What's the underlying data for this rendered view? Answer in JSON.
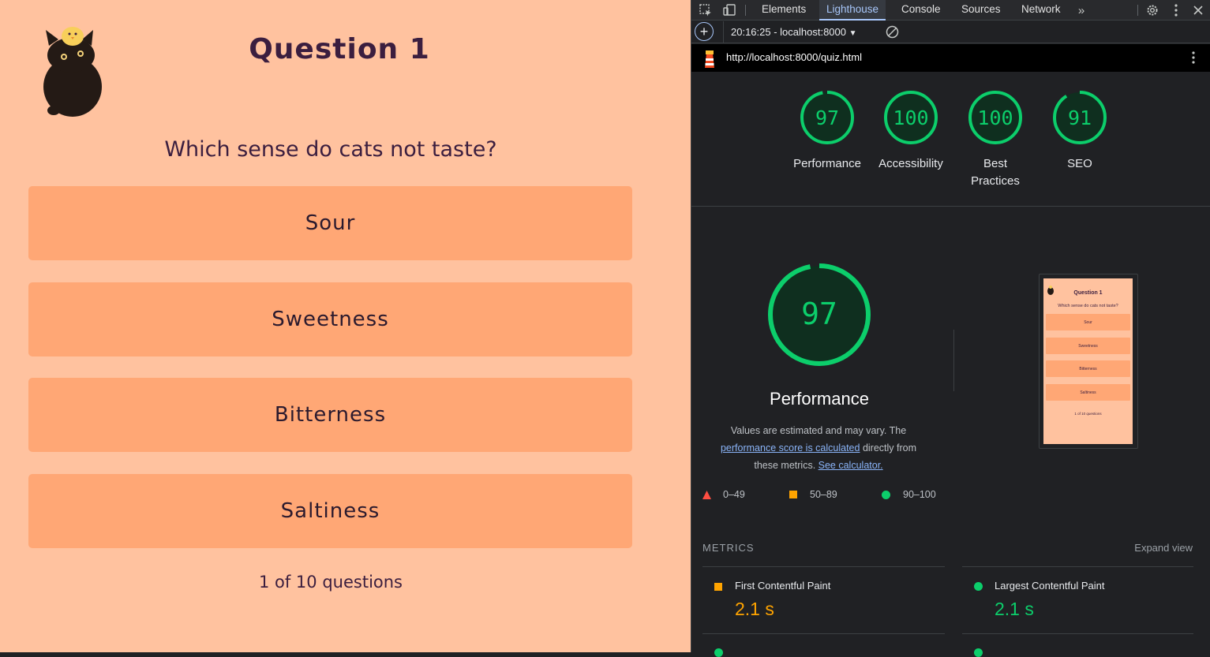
{
  "quiz": {
    "title": "Question 1",
    "question": "Which sense do cats not taste?",
    "answers": [
      "Sour",
      "Sweetness",
      "Bitterness",
      "Saltiness"
    ],
    "count": "1 of 10 questions"
  },
  "devtools": {
    "tabs": [
      "Elements",
      "Lighthouse",
      "Console",
      "Sources",
      "Network"
    ],
    "active_tab": "Lighthouse",
    "report_selector": "20:16:25 - localhost:8000",
    "url": "http://localhost:8000/quiz.html",
    "scores": [
      {
        "value": "97",
        "label": "Performance"
      },
      {
        "value": "100",
        "label": "Accessibility"
      },
      {
        "value": "100",
        "label": "Best Practices"
      },
      {
        "value": "91",
        "label": "SEO"
      }
    ],
    "score_fractions": [
      0.97,
      1.0,
      1.0,
      0.91
    ],
    "performance": {
      "score": "97",
      "title": "Performance",
      "desc_1": "Values are estimated and may vary. The",
      "desc_link_1": "performance score is calculated",
      "desc_2": " directly from",
      "desc_3": "these metrics. ",
      "desc_link_2": "See calculator.",
      "legend": [
        "0–49",
        "50–89",
        "90–100"
      ]
    },
    "metrics_label": "METRICS",
    "expand_label": "Expand view",
    "metrics": [
      {
        "name": "First Contentful Paint",
        "value": "2.1 s",
        "status": "average"
      },
      {
        "name": "Largest Contentful Paint",
        "value": "2.1 s",
        "status": "pass"
      }
    ],
    "colors": {
      "pass": "#0cce6b",
      "average": "#ffa400",
      "fail": "#ff4e42",
      "accent": "#a8c7fa"
    }
  }
}
